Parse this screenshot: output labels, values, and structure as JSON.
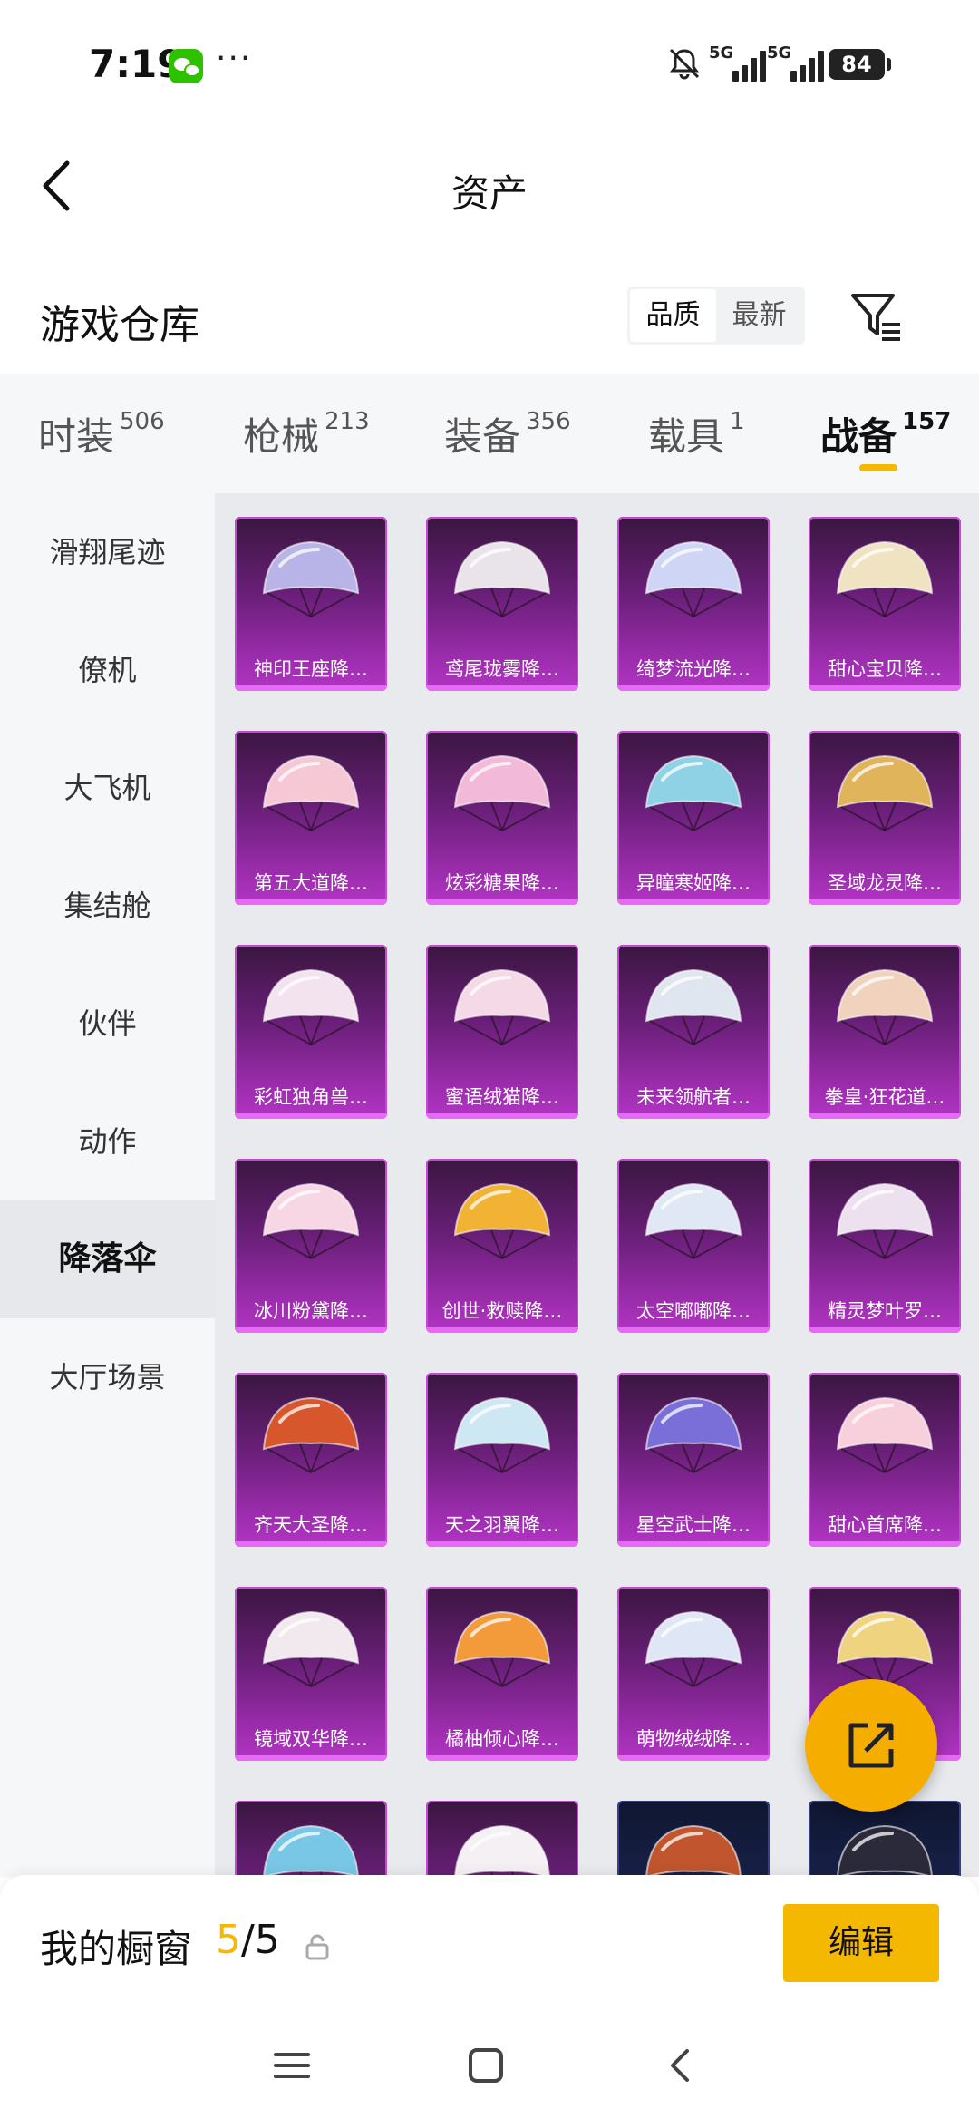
{
  "status": {
    "time": "7:19",
    "dots": "···",
    "network1": "5G",
    "network2": "5G",
    "battery": "84"
  },
  "header": {
    "title": "资产"
  },
  "warehouse": {
    "title": "游戏仓库",
    "sort_quality": "品质",
    "sort_latest": "最新"
  },
  "tabs": [
    {
      "label": "时装",
      "count": "506"
    },
    {
      "label": "枪械",
      "count": "213"
    },
    {
      "label": "装备",
      "count": "356"
    },
    {
      "label": "载具",
      "count": "1"
    },
    {
      "label": "战备",
      "count": "157"
    }
  ],
  "sidebar": [
    {
      "label": "滑翔尾迹"
    },
    {
      "label": "僚机"
    },
    {
      "label": "大飞机"
    },
    {
      "label": "集结舱"
    },
    {
      "label": "伙伴"
    },
    {
      "label": "动作"
    },
    {
      "label": "降落伞"
    },
    {
      "label": "大厅场景"
    }
  ],
  "items": [
    {
      "name": "神印王座降…",
      "color": "#b9b4e8"
    },
    {
      "name": "鸢尾珑雾降…",
      "color": "#e9e4ea"
    },
    {
      "name": "绮梦流光降…",
      "color": "#cfd6f5"
    },
    {
      "name": "甜心宝贝降…",
      "color": "#f0e3c2"
    },
    {
      "name": "第五大道降…",
      "color": "#f6c7d4"
    },
    {
      "name": "炫彩糖果降…",
      "color": "#f2b9d8"
    },
    {
      "name": "异瞳寒姬降…",
      "color": "#8fd2e6"
    },
    {
      "name": "圣域龙灵降…",
      "color": "#e0b45a"
    },
    {
      "name": "彩虹独角兽…",
      "color": "#f3e3ee"
    },
    {
      "name": "蜜语绒猫降…",
      "color": "#f5d9e6"
    },
    {
      "name": "未来领航者…",
      "color": "#dfe6f0"
    },
    {
      "name": "拳皇·狂花道…",
      "color": "#f1d3bd"
    },
    {
      "name": "冰川粉黛降…",
      "color": "#f7d7e4"
    },
    {
      "name": "创世·救赎降…",
      "color": "#f2b233"
    },
    {
      "name": "太空嘟嘟降…",
      "color": "#dfe8f4"
    },
    {
      "name": "精灵梦叶罗…",
      "color": "#ede0ef"
    },
    {
      "name": "齐天大圣降…",
      "color": "#d8562c"
    },
    {
      "name": "天之羽翼降…",
      "color": "#cde7f3"
    },
    {
      "name": "星空武士降…",
      "color": "#7a6fd9"
    },
    {
      "name": "甜心首席降…",
      "color": "#f7d0dc"
    },
    {
      "name": "镜域双华降…",
      "color": "#f2e9ef"
    },
    {
      "name": "橘柚倾心降…",
      "color": "#f39b3a"
    },
    {
      "name": "萌物绒绒降…",
      "color": "#dfe7f6"
    },
    {
      "name": "",
      "color": "#f0d37e"
    },
    {
      "name": "",
      "color": "#79c7e6"
    },
    {
      "name": "",
      "color": "#f4f0f4"
    },
    {
      "name": "",
      "color": "#c0552e"
    },
    {
      "name": "",
      "color": "#2a2a3a"
    }
  ],
  "bottom": {
    "label": "我的橱窗",
    "current": "5",
    "separator": "/",
    "total": "5",
    "edit": "编辑"
  }
}
